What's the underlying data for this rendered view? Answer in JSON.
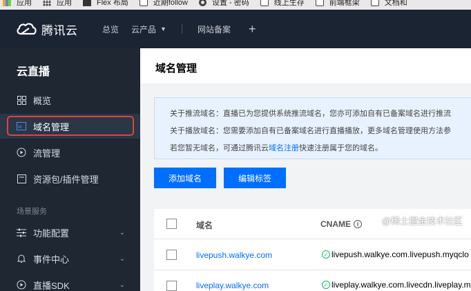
{
  "bookmarks": [
    {
      "label": "应用",
      "icon": "grid-color-icon"
    },
    {
      "label": "应用",
      "icon": "grid-icon"
    },
    {
      "label": "Flex 布局",
      "icon": "bookmark-icon"
    },
    {
      "label": "近期follow",
      "icon": "folder-icon"
    },
    {
      "label": "设置 - 密码",
      "icon": "gear-icon"
    },
    {
      "label": "线上生存",
      "icon": "folder-icon"
    },
    {
      "label": "前端框架",
      "icon": "folder-icon"
    },
    {
      "label": "文档和",
      "icon": "folder-icon"
    }
  ],
  "topnav": {
    "brand": "腾讯云",
    "overview": "总览",
    "products": "云产品",
    "filing": "网站备案",
    "plus": "+"
  },
  "sidebar": {
    "title": "云直播",
    "items": [
      {
        "label": "概览",
        "icon": "grid-icon"
      },
      {
        "label": "域名管理",
        "icon": "domain-icon"
      },
      {
        "label": "流管理",
        "icon": "play-circle-icon"
      },
      {
        "label": "资源包/插件管理",
        "icon": "package-icon"
      }
    ],
    "group_label": "场景服务",
    "group_items": [
      {
        "label": "功能配置",
        "icon": "sliders-icon"
      },
      {
        "label": "事件中心",
        "icon": "bell-icon"
      },
      {
        "label": "直播SDK",
        "icon": "sdk-icon"
      }
    ]
  },
  "main": {
    "title": "域名管理",
    "notice": {
      "line1": "关于推流域名：直播已为您提供系统推流域名，您亦可添加自有已备案域名进行推流",
      "line2": "关于播放域名：您需要添加自有已备案域名进行直播播放，更多域名管理使用方法参",
      "line3_prefix": "若您暂无域名，可通过腾讯云",
      "line3_link": "域名注册",
      "line3_suffix": "快速注册属于您的域名。"
    },
    "buttons": {
      "add": "添加域名",
      "edit_tags": "编辑标签"
    },
    "table": {
      "headers": {
        "domain": "域名",
        "cname": "CNAME"
      },
      "rows": [
        {
          "domain": "livepush.walkye.com",
          "cname": "livepush.walkye.com.livepush.myqclo"
        },
        {
          "domain": "liveplay.walkye.com",
          "cname": "liveplay.walkye.com.livecdn.liveplay.m"
        }
      ]
    }
  },
  "watermark": "@稀土掘金技术社区",
  "colors": {
    "accent": "#006eff",
    "nav_bg": "#1b2432",
    "sidebar_bg": "#1f2733",
    "highlight": "#e0443a",
    "ok": "#0abf5b"
  }
}
